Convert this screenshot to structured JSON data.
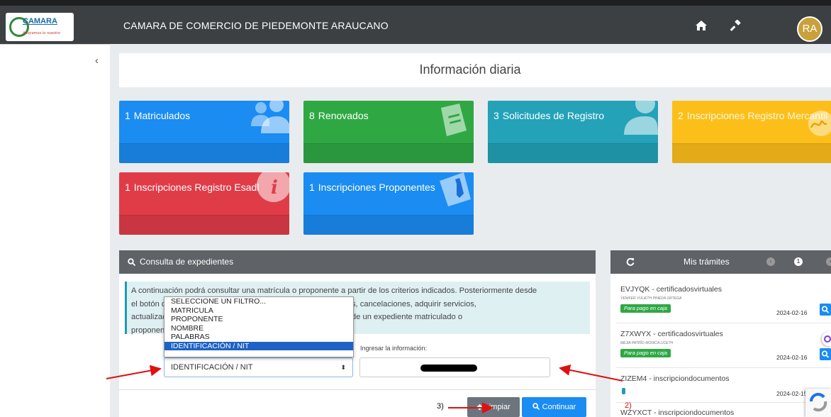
{
  "header": {
    "logo_text": "CAMARA",
    "logo_tagline": "Apoyamos lo nuestro",
    "title": "CAMARA DE COMERCIO DE PIEDEMONTE ARAUCANO",
    "avatar_initials": "RA"
  },
  "sidebar": {
    "collapse_symbol": "‹"
  },
  "info": {
    "title": "Información diaria",
    "cards": [
      {
        "count": "1",
        "label": "Matriculados",
        "color": "#1a8cf2",
        "icon": "users-icon"
      },
      {
        "count": "8",
        "label": "Renovados",
        "color": "#2fa844",
        "icon": "document-icon"
      },
      {
        "count": "3",
        "label": "Solicitudes de Registro",
        "color": "#23a2b8",
        "icon": "user-icon"
      },
      {
        "count": "2",
        "label": "Inscripciones Registro Mercantil",
        "color": "#fcbf1a",
        "icon": "signature-icon"
      },
      {
        "count": "1",
        "label": "Inscripciones Registro Esadl",
        "color": "#e03c48",
        "icon": "info-icon"
      },
      {
        "count": "1",
        "label": "Inscripciones Proponentes",
        "color": "#1a8cf2",
        "icon": "tie-icon"
      }
    ]
  },
  "consulta": {
    "title": "Consulta de expedientes",
    "note_lines": [
      "A continuación podrá consultar una matrícula o proponente a partir de los criterios indicados. Posteriormente desde",
      "el botón de continuar podrá realizar renovaciones, inscripciones, cancelaciones, adquirir servicios,",
      "actualizaciones y demás trámites que requiera de la selección de un expediente matriculado o",
      "proponente."
    ],
    "input_label": "Ingresar la información:",
    "select_value": "IDENTIFICACIÓN / NIT",
    "options": [
      "SELECCIONE UN FILTRO...",
      "MATRICULA",
      "PROPONENTE",
      "NOMBRE",
      "PALABRAS",
      "IDENTIFICACIÓN / NIT"
    ],
    "selected_index": 5,
    "clear_label": "Limpiar",
    "continue_label": "Continuar"
  },
  "annotations": {
    "step2": "2)",
    "step3": "3)",
    "arrow_color": "#e01010"
  },
  "tramites": {
    "title": "Mis trámites",
    "pages": [
      "1"
    ],
    "items": [
      {
        "code": "EVJYQK - certificadosvirtuales",
        "name": "YENIFER YULIETH PINEDA ORTEGA",
        "status": "Para pago en caja",
        "date": "2024-02-16"
      },
      {
        "code": "Z7XWYX - certificadosvirtuales",
        "name": "MEJIA PATIÑO MONICA LICETH",
        "status": "Para pago en caja",
        "date": "2024-02-16"
      },
      {
        "code": "ZIZEM4 - inscripciondocumentos",
        "name": "",
        "status": "",
        "date": "2024-02-15"
      },
      {
        "code": "WZYXCT - inscripciondocumentos",
        "name": "",
        "status": "",
        "date": ""
      }
    ]
  }
}
